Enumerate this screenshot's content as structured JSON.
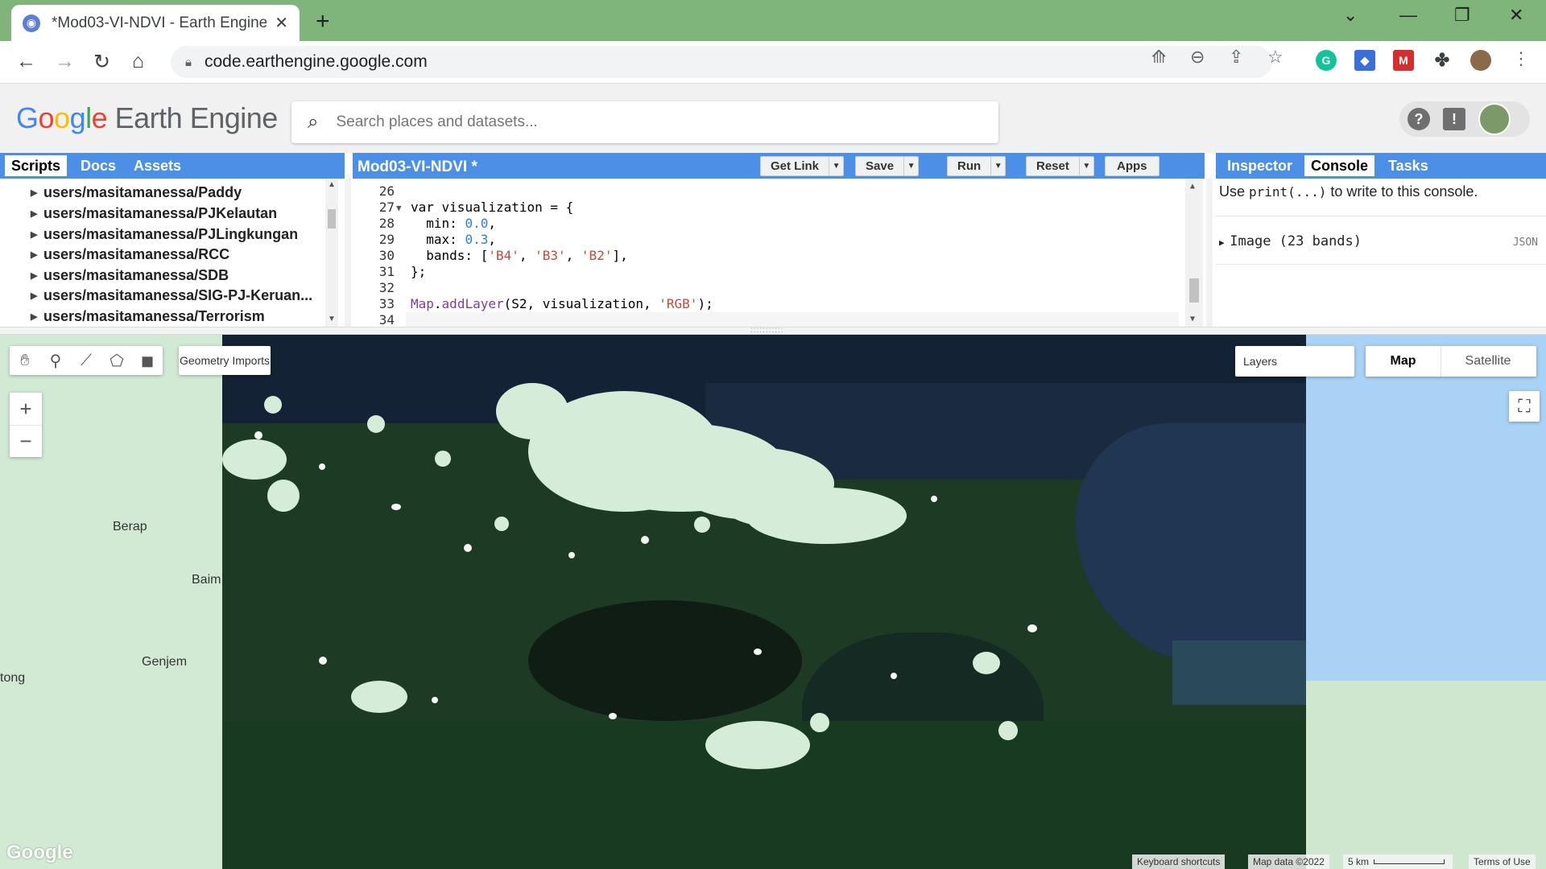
{
  "browser": {
    "tab_title": "*Mod03-VI-NDVI - Earth Engine C",
    "url": "code.earthengine.google.com",
    "new_tab": "+",
    "close_tab": "✕"
  },
  "header": {
    "logo_google": [
      "G",
      "o",
      "o",
      "g",
      "l",
      "e"
    ],
    "logo_rest": " Earth Engine",
    "search_placeholder": "Search places and datasets..."
  },
  "left_panel": {
    "tabs": [
      "Scripts",
      "Docs",
      "Assets"
    ],
    "active_tab": "Scripts",
    "scripts": [
      "users/masitamanessa/Paddy",
      "users/masitamanessa/PJKelautan",
      "users/masitamanessa/PJLingkungan",
      "users/masitamanessa/RCC",
      "users/masitamanessa/SDB",
      "users/masitamanessa/SIG-PJ-Keruan...",
      "users/masitamanessa/Terrorism"
    ]
  },
  "editor": {
    "script_name": "Mod03-VI-NDVI *",
    "buttons": {
      "get_link": "Get Link",
      "save": "Save",
      "run": "Run",
      "reset": "Reset",
      "apps": "Apps"
    },
    "line_numbers": [
      "26",
      "27",
      "28",
      "29",
      "30",
      "31",
      "32",
      "33",
      "34"
    ]
  },
  "right_panel": {
    "tabs": [
      "Inspector",
      "Console",
      "Tasks"
    ],
    "active_tab": "Console",
    "hint_prefix": "Use ",
    "hint_code": "print(...)",
    "hint_suffix": " to write to this console.",
    "output_item": "Image (23 bands)",
    "json_label": "JSON"
  },
  "map": {
    "geometry_imports": "Geometry Imports",
    "layers": "Layers",
    "map_type": [
      "Map",
      "Satellite"
    ],
    "active_map_type": "Map",
    "zoom_in": "+",
    "zoom_out": "−",
    "places": [
      "Berap",
      "Baim",
      "Genjem",
      "tong"
    ],
    "watermark": "Google",
    "footer": {
      "keyboard": "Keyboard shortcuts",
      "map_data": "Map data ©2022",
      "scale": "5 km",
      "terms": "Terms of Use"
    }
  }
}
